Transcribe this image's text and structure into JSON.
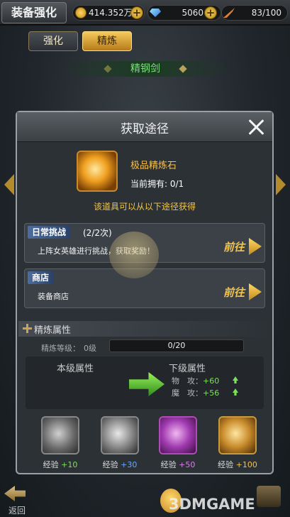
{
  "topbar": {
    "title": "装备强化",
    "gold": "414.352万",
    "diamonds": "5060",
    "stamina": "83/100"
  },
  "tabs": {
    "strengthen": "强化",
    "refine": "精炼"
  },
  "weapon": {
    "name": "精钢剑"
  },
  "popup": {
    "title": "获取途径",
    "item_name": "极品精炼石",
    "owned_label": "当前拥有:",
    "owned_value": "0/1",
    "hint": "该道具可以从以下途径获得",
    "routes": [
      {
        "tag": "日常挑战",
        "count": "(2/2次)",
        "desc": "上阵女英雄进行挑战，获取奖励！",
        "action": "前往"
      },
      {
        "tag": "商店",
        "count": "",
        "desc": "装备商店",
        "action": "前往"
      }
    ]
  },
  "refine": {
    "title": "精炼属性",
    "level_label": "精炼等级：",
    "level_value": "0级",
    "xp_text": "0/20",
    "xp_fraction": 0,
    "current_label": "本级属性",
    "next_label": "下级属性",
    "next_lines": [
      {
        "name": "物　攻：",
        "value": "+60"
      },
      {
        "name": "魔　攻：",
        "value": "+56"
      }
    ],
    "stones": [
      {
        "label": "经验",
        "value": "+10"
      },
      {
        "label": "经验",
        "value": "+30"
      },
      {
        "label": "经验",
        "value": "+50"
      },
      {
        "label": "经验",
        "value": "+100"
      }
    ]
  },
  "bottom": {
    "back_label": "返回"
  },
  "watermark": "3DMGAME"
}
